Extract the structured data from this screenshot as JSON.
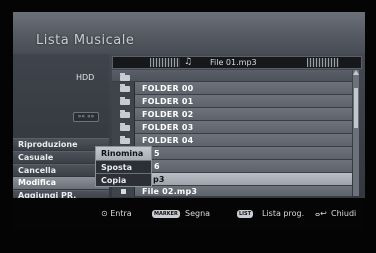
{
  "screen": {
    "title": "Lista Musicale"
  },
  "left": {
    "hdd_label": "HDD",
    "osd_label": "»« «»"
  },
  "menu": {
    "items": [
      {
        "label": "Riproduzione"
      },
      {
        "label": "Casuale"
      },
      {
        "label": "Cancella"
      },
      {
        "label": "Modifica"
      },
      {
        "label": "Aggiungi PR."
      }
    ]
  },
  "header": {
    "note_icon": "music-note-icon",
    "now_playing": "File 01.mp3"
  },
  "list": {
    "rows": [
      {
        "label": "FOLDER 00",
        "icon": "folder-icon"
      },
      {
        "label": "FOLDER 01",
        "icon": "folder-icon"
      },
      {
        "label": "FOLDER 02",
        "icon": "folder-icon"
      },
      {
        "label": "FOLDER 03",
        "icon": "folder-icon"
      },
      {
        "label": "FOLDER 04",
        "icon": "folder-icon"
      },
      {
        "label": "5",
        "icon": "folder-icon"
      },
      {
        "label": "6",
        "icon": "folder-icon"
      },
      {
        "label": "p3",
        "icon": "file-icon"
      },
      {
        "label": "File 02.mp3",
        "icon": "file-icon"
      }
    ]
  },
  "popup": {
    "items": [
      {
        "label": "Rinomina"
      },
      {
        "label": "Sposta"
      },
      {
        "label": "Copia"
      }
    ]
  },
  "footer": {
    "enter": "⊙ Entra",
    "marker_badge": "MARKER",
    "mark": "Segna",
    "list_badge": "LIST",
    "prog": "Lista prog.",
    "return_symbol": "ⴰ↩",
    "close": "Chiudi"
  }
}
